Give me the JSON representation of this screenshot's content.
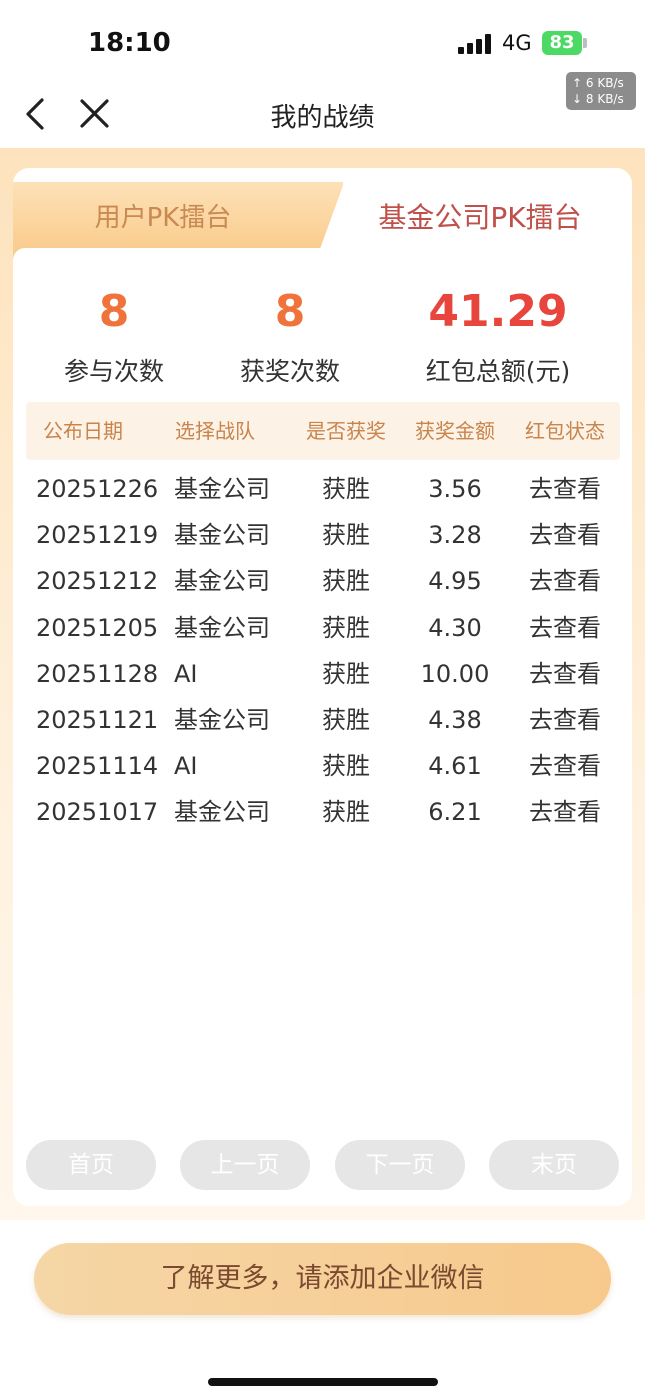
{
  "status_bar": {
    "time": "18:10",
    "network": "4G",
    "battery": "83",
    "speed_up": "↑ 6 KB/s",
    "speed_down": "↓ 8 KB/s"
  },
  "nav": {
    "title": "我的战绩",
    "back_icon": "chevron-left-icon",
    "close_icon": "close-icon"
  },
  "tabs": [
    {
      "label": "用户PK擂台",
      "active": false
    },
    {
      "label": "基金公司PK擂台",
      "active": true
    }
  ],
  "stats": [
    {
      "value": "8",
      "label": "参与次数",
      "color": "#f0733c"
    },
    {
      "value": "8",
      "label": "获奖次数",
      "color": "#f0733c"
    },
    {
      "value": "41.29",
      "label": "红包总额(元)",
      "color": "#e8453c"
    }
  ],
  "table": {
    "headers": [
      "公布日期",
      "选择战队",
      "是否获奖",
      "获奖金额",
      "红包状态"
    ],
    "rows": [
      [
        "20251226",
        "基金公司",
        "获胜",
        "3.56",
        "去查看"
      ],
      [
        "20251219",
        "基金公司",
        "获胜",
        "3.28",
        "去查看"
      ],
      [
        "20251212",
        "基金公司",
        "获胜",
        "4.95",
        "去查看"
      ],
      [
        "20251205",
        "基金公司",
        "获胜",
        "4.30",
        "去查看"
      ],
      [
        "20251128",
        "AI",
        "获胜",
        "10.00",
        "去查看"
      ],
      [
        "20251121",
        "基金公司",
        "获胜",
        "4.38",
        "去查看"
      ],
      [
        "20251114",
        "AI",
        "获胜",
        "4.61",
        "去查看"
      ],
      [
        "20251017",
        "基金公司",
        "获胜",
        "6.21",
        "去查看"
      ]
    ]
  },
  "pagination": {
    "first": "首页",
    "prev": "上一页",
    "next": "下一页",
    "last": "末页"
  },
  "cta": {
    "label": "了解更多，请添加企业微信"
  },
  "colors": {
    "accent_orange": "#f0733c",
    "accent_red": "#e8453c",
    "header_text": "#c9844c",
    "cta_bg": "#f7c98c"
  }
}
